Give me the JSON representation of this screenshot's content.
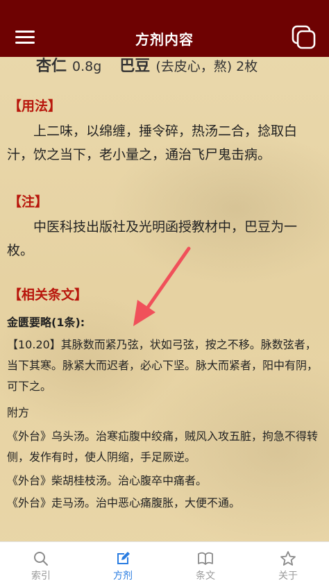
{
  "header": {
    "title": "方剂内容"
  },
  "top_line": {
    "item1_name": "杏仁",
    "item1_amount": "0.8g",
    "item2_name": "巴豆",
    "item2_note": "(去皮心，熬) 2枚"
  },
  "usage": {
    "heading": "【用法】",
    "text": "上二味，以绵缠，捶令碎，热汤二合，捻取白汁，饮之当下，老小量之，通治飞尸鬼击病。"
  },
  "note": {
    "heading": "【注】",
    "text": "中医科技出版社及光明函授教材中，巴豆为一枚。"
  },
  "related": {
    "heading": "【相关条文】",
    "book": "金匮要略(1条):",
    "clause": "【10.20】其脉数而紧乃弦，状如弓弦，按之不移。脉数弦者，当下其寒。脉紧大而迟者，必心下坚。脉大而紧者，阳中有阴，可下之。",
    "appendix_label": "附方",
    "lines": [
      "《外台》乌头汤。治寒疝腹中绞痛，贼风入攻五脏，拘急不得转侧，发作有时，使人阴缩，手足厥逆。",
      "《外台》柴胡桂枝汤。治心腹卒中痛者。",
      "《外台》走马汤。治中恶心痛腹胀，大便不通。"
    ]
  },
  "tabs": [
    {
      "label": "索引",
      "icon": "search-icon"
    },
    {
      "label": "方剂",
      "icon": "edit-icon"
    },
    {
      "label": "条文",
      "icon": "book-icon"
    },
    {
      "label": "关于",
      "icon": "star-icon"
    }
  ],
  "colors": {
    "header": "#6e0202",
    "heading_red": "#b8160c",
    "active_tab": "#2a7de1",
    "arrow": "#f0505a"
  }
}
